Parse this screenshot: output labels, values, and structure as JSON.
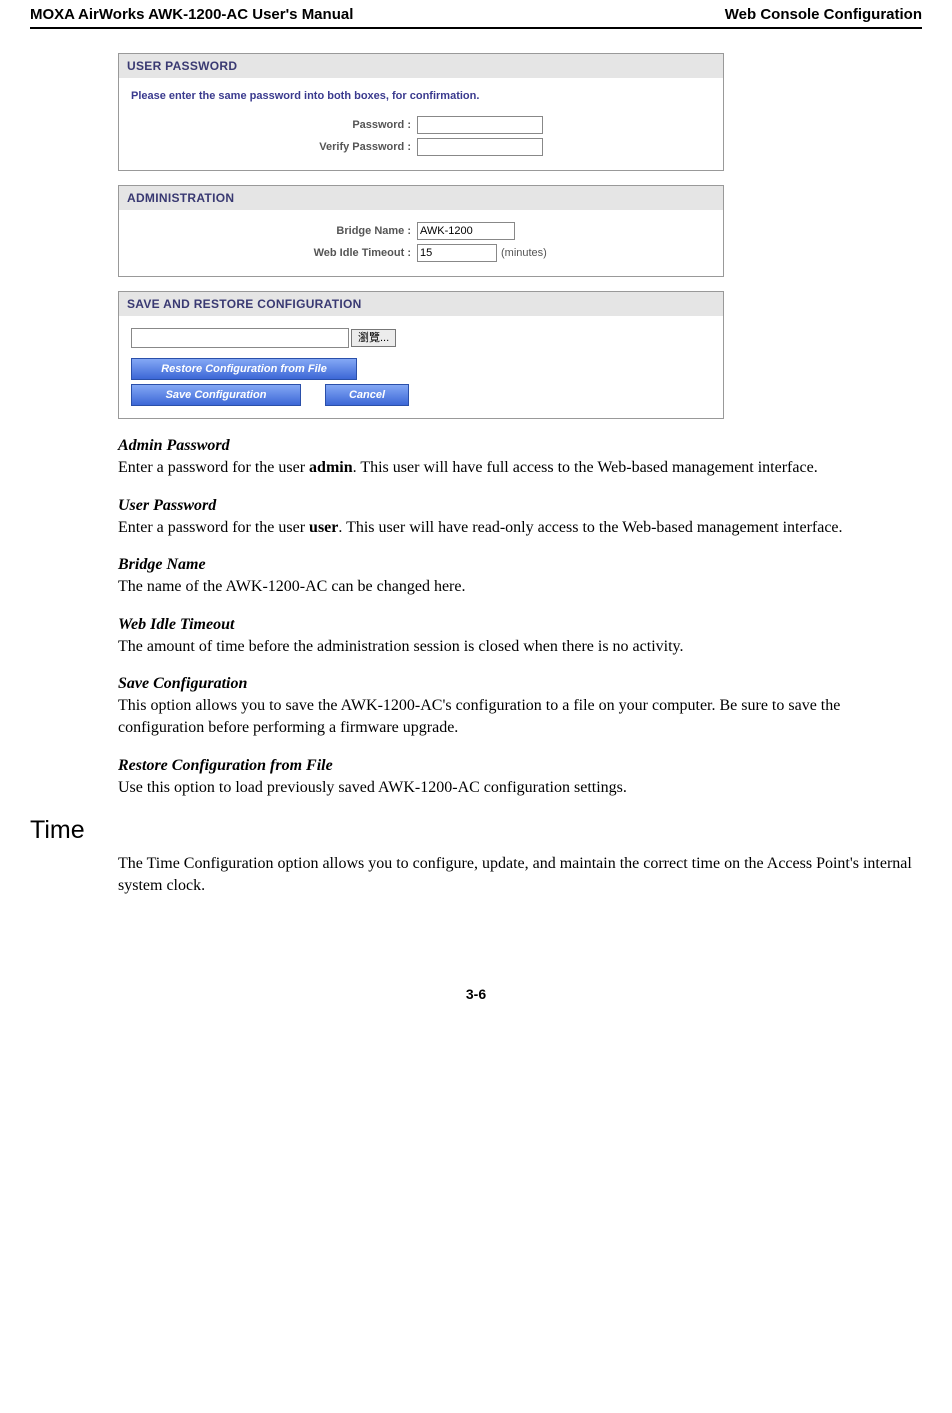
{
  "header": {
    "left": "MOXA AirWorks AWK-1200-AC User's Manual",
    "right": "Web Console Configuration"
  },
  "panels": {
    "user_password": {
      "title": "USER PASSWORD",
      "instruction": "Please enter the same password into both boxes, for confirmation.",
      "password_label": "Password :",
      "verify_label": "Verify Password :",
      "password_value": "",
      "verify_value": ""
    },
    "administration": {
      "title": "ADMINISTRATION",
      "bridge_label": "Bridge Name :",
      "bridge_value": "AWK-1200",
      "timeout_label": "Web Idle Timeout :",
      "timeout_value": "15",
      "timeout_unit": "(minutes)"
    },
    "save_restore": {
      "title": "SAVE AND RESTORE CONFIGURATION",
      "file_value": "",
      "browse_label": "瀏覽...",
      "restore_btn": "Restore Configuration from File",
      "save_btn": "Save Configuration",
      "cancel_btn": "Cancel"
    }
  },
  "doc": {
    "admin_pw_h": "Admin Password",
    "admin_pw_p1": "Enter a password for the user ",
    "admin_pw_bold": "admin",
    "admin_pw_p2": ". This user will have full access to the Web-based management interface.",
    "user_pw_h": "User Password",
    "user_pw_p1": "Enter a password for the user ",
    "user_pw_bold": "user",
    "user_pw_p2": ". This user will have read-only access to the Web-based management interface.",
    "bridge_h": "Bridge Name",
    "bridge_p": "The name of the AWK-1200-AC can be changed here.",
    "idle_h": "Web Idle Timeout",
    "idle_p": "The amount of time before the administration session is closed when there is no activity.",
    "savecfg_h": "Save Configuration",
    "savecfg_p": "This option allows you to save the AWK-1200-AC's configuration to a file on your computer. Be sure to save the configuration before performing a firmware upgrade.",
    "restore_h": "Restore Configuration from File",
    "restore_p": "Use this option to load previously saved AWK-1200-AC configuration settings.",
    "time_h": "Time",
    "time_p": "The Time Configuration option allows you to configure, update, and maintain the correct time on the Access Point's internal system clock."
  },
  "page_number": "3-6"
}
